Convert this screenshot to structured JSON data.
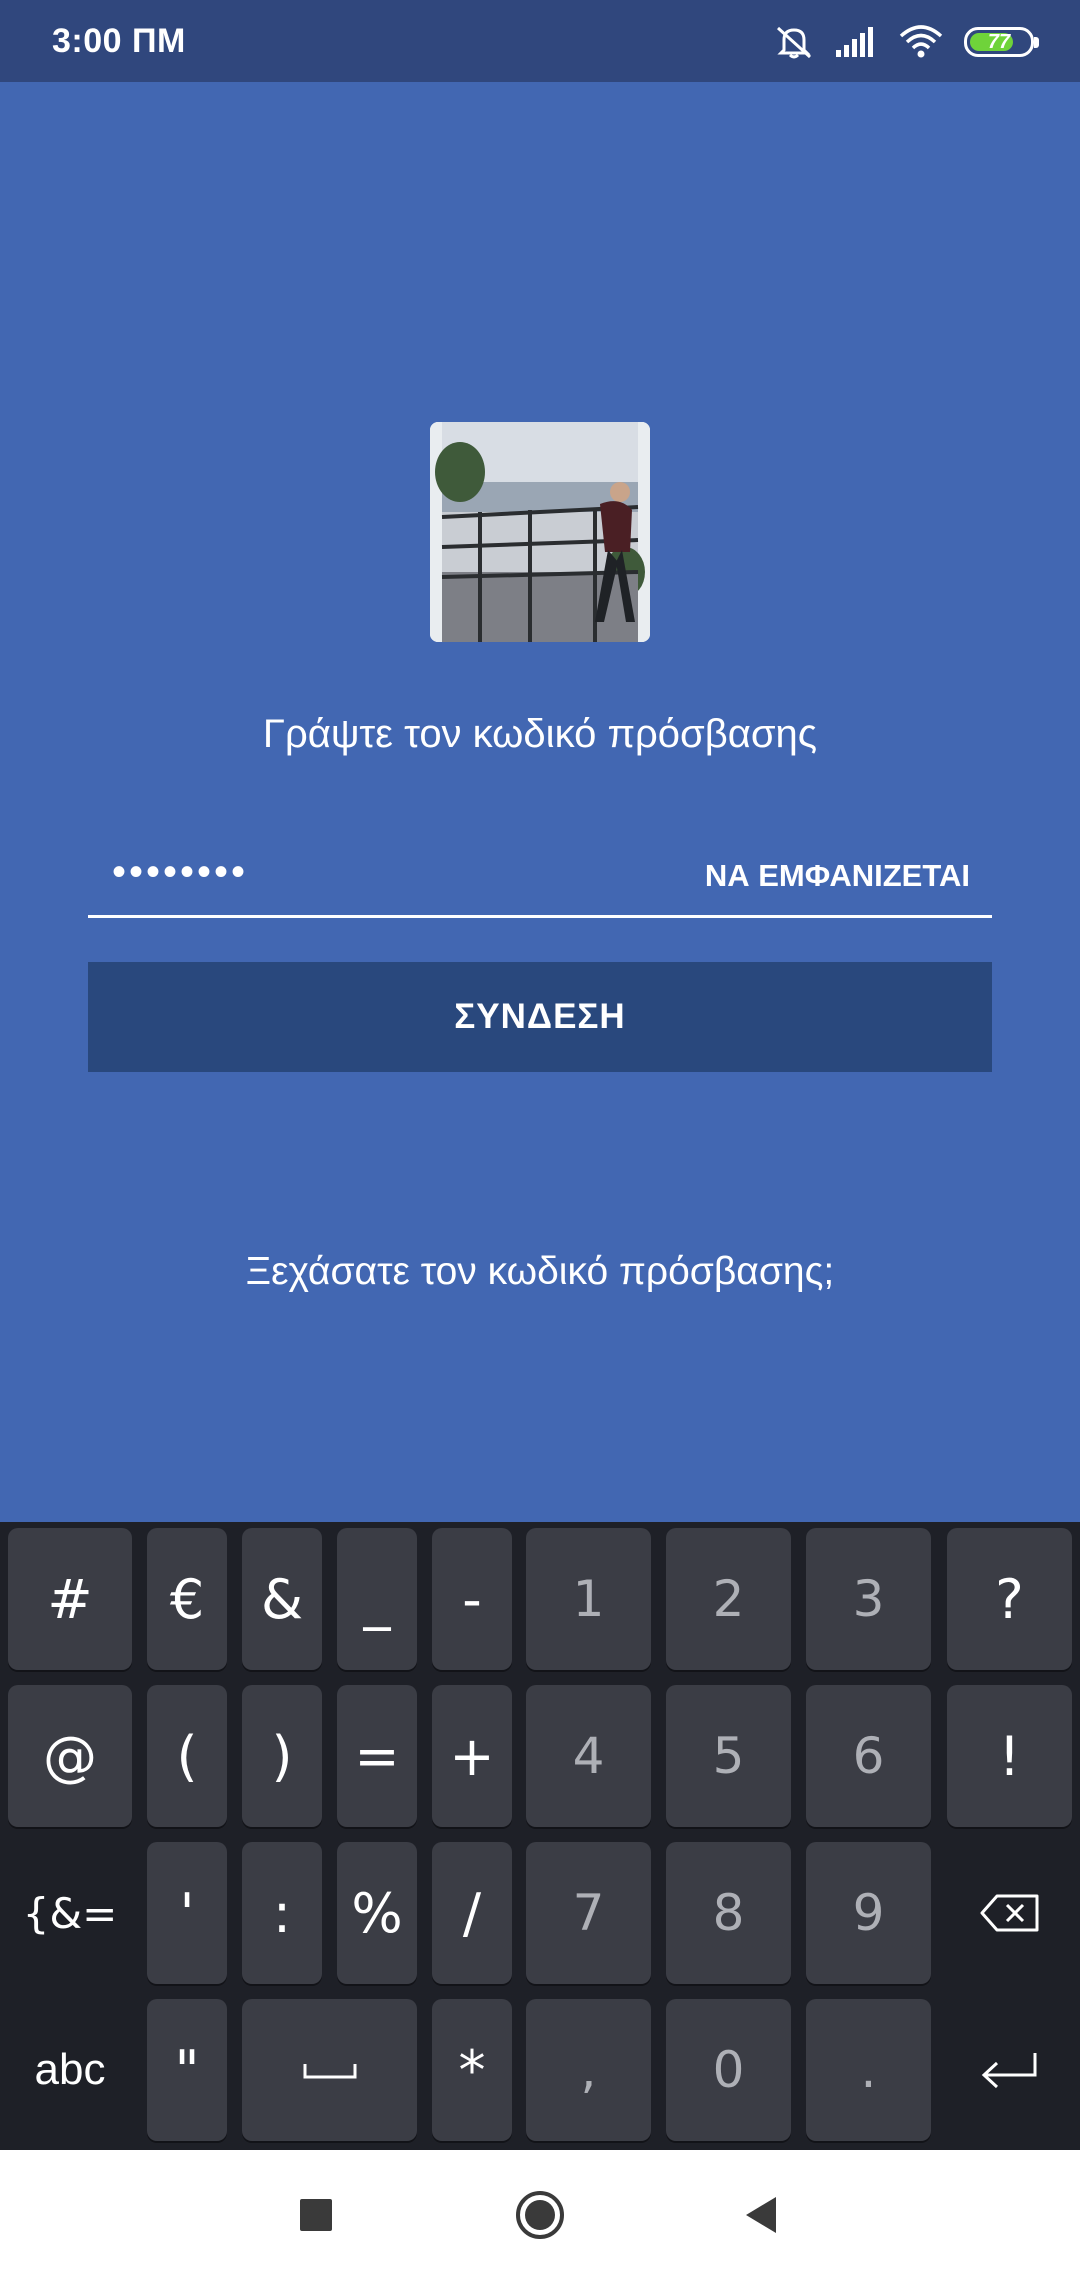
{
  "status_bar": {
    "time": "3:00 ΠΜ",
    "battery": "77",
    "battery_level": 0.77,
    "icons": [
      "mute-icon",
      "signal-icon",
      "wifi-icon",
      "battery-icon"
    ]
  },
  "login": {
    "avatar_icon": "profile-photo",
    "prompt": "Γράψτε τον κωδικό πρόσβασης",
    "password_value": "••••••••",
    "show_label": "ΝΑ ΕΜΦΑΝΙΖΕΤΑΙ",
    "login_label": "ΣΥΝΔΕΣΗ",
    "forgot_label": "Ξεχάσατε τον κωδικό πρόσβασης;"
  },
  "keyboard": {
    "rows": [
      [
        "#",
        "€",
        "&",
        "_",
        "-",
        "1",
        "2",
        "3",
        "?"
      ],
      [
        "@",
        "(",
        ")",
        "=",
        "+",
        "4",
        "5",
        "6",
        "!"
      ],
      [
        "{&=",
        "'",
        ":",
        "%",
        "/",
        "7",
        "8",
        "9",
        "⌫"
      ],
      [
        "abc",
        "\"",
        "␣",
        "*",
        ",",
        "0",
        ".",
        "↵"
      ]
    ]
  },
  "colors": {
    "background": "#4267b2",
    "status_bar": "#30477d",
    "button": "#29487d",
    "keyboard": "#1e2027",
    "key": "#3b3d45"
  },
  "navigation": {
    "icons": [
      "recents-icon",
      "home-icon",
      "back-icon"
    ]
  }
}
